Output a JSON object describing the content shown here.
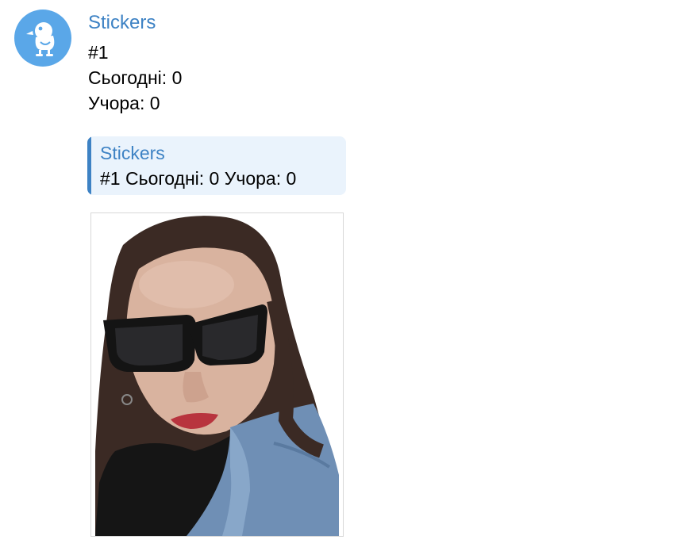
{
  "message": {
    "sender": "Stickers",
    "lines": [
      "#1",
      "Сьогодні: 0",
      "Учора: 0"
    ]
  },
  "reply": {
    "title": "Stickers",
    "text": "#1 Сьогодні: 0 Учора: 0"
  },
  "avatar": {
    "icon": "duck-bot-icon",
    "color": "#5aa7e8"
  },
  "sticker": {
    "description_icon": "sticker-photo"
  },
  "colors": {
    "accent": "#3d82c4",
    "reply_bg": "#eaf3fc"
  }
}
